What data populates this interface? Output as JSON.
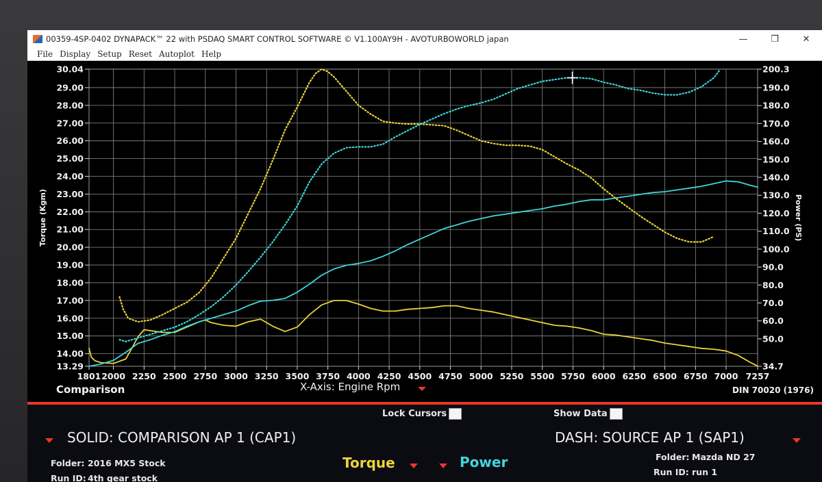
{
  "window": {
    "title": "00359-4SP-0402 DYNAPACK™ 22 with PSDAQ SMART CONTROL SOFTWARE © V1.100AY9H - AVOTURBOWORLD japan",
    "minimize": "—",
    "maximize": "❐",
    "close": "✕"
  },
  "menu": [
    "File",
    "Display",
    "Setup",
    "Reset",
    "Autoplot",
    "Help"
  ],
  "footer": {
    "comparison_label": "Comparison",
    "xaxis_label": "X-Axis: Engine Rpm",
    "din_label": "DIN 70020 (1976)"
  },
  "controls": {
    "lock_cursors": "Lock Cursors",
    "show_data": "Show Data"
  },
  "panel": {
    "solid_title": "SOLID: COMPARISON AP 1 (CAP1)",
    "dash_title": "DASH: SOURCE AP 1 (SAP1)",
    "left_folder_label": "Folder:",
    "left_folder_value": "2016 MX5 Stock",
    "left_runid_label": "Run ID:",
    "left_runid_value": "4th gear stock",
    "right_folder_label": "Folder:",
    "right_folder_value": "Mazda ND 27",
    "right_runid_label": "Run ID:",
    "right_runid_value": "run 1",
    "torque_label": "Torque",
    "power_label": "Power"
  },
  "colors": {
    "torque": "#ecd43a",
    "power": "#3fd6dc",
    "accent": "#e8382a",
    "grid": "#8a8a8a"
  },
  "chart_data": {
    "type": "line",
    "title": "",
    "xlabel": "X-Axis: Engine Rpm",
    "ylabel_left": "Torque (Kgm)",
    "ylabel_right": "Power (PS)",
    "xlim": [
      1801,
      7257
    ],
    "ylim_left": [
      13.29,
      30.04
    ],
    "ylim_right": [
      34.7,
      200.3
    ],
    "x_ticks": [
      "1801",
      "2000",
      "2250",
      "2500",
      "2750",
      "3000",
      "3250",
      "3500",
      "3750",
      "4000",
      "4250",
      "4500",
      "4750",
      "5000",
      "5250",
      "5500",
      "5750",
      "6000",
      "6250",
      "6500",
      "6750",
      "7000",
      "7257"
    ],
    "left_ticks": [
      "30.04",
      "29.00",
      "28.00",
      "27.00",
      "26.00",
      "25.00",
      "24.00",
      "23.00",
      "22.00",
      "21.00",
      "20.00",
      "19.00",
      "18.00",
      "17.00",
      "16.00",
      "15.00",
      "14.00",
      "13.29"
    ],
    "right_ticks": [
      "200.3",
      "190.0",
      "180.0",
      "170.0",
      "160.0",
      "150.0",
      "140.0",
      "130.0",
      "120.0",
      "110.0",
      "100.0",
      "90.0",
      "80.0",
      "70.0",
      "60.0",
      "50.0",
      "34.7"
    ],
    "grid": true,
    "series": [
      {
        "name": "Torque",
        "style": "solid",
        "axis": "left",
        "color": "#ecd43a",
        "x": [
          1801,
          1820,
          1850,
          1900,
          2000,
          2100,
          2150,
          2200,
          2250,
          2300,
          2400,
          2500,
          2600,
          2700,
          2750,
          2800,
          2900,
          3000,
          3100,
          3200,
          3300,
          3400,
          3500,
          3600,
          3700,
          3800,
          3900,
          4000,
          4100,
          4200,
          4300,
          4400,
          4500,
          4600,
          4700,
          4800,
          4900,
          5000,
          5100,
          5200,
          5300,
          5400,
          5500,
          5600,
          5700,
          5800,
          5900,
          6000,
          6100,
          6200,
          6300,
          6400,
          6500,
          6600,
          6700,
          6800,
          6900,
          7000,
          7100,
          7200,
          7257
        ],
        "y": [
          14.3,
          13.8,
          13.6,
          13.5,
          13.45,
          13.7,
          14.3,
          14.95,
          15.35,
          15.3,
          15.2,
          15.2,
          15.5,
          15.8,
          15.9,
          15.75,
          15.6,
          15.55,
          15.8,
          15.95,
          15.55,
          15.25,
          15.5,
          16.2,
          16.75,
          17.0,
          17.0,
          16.8,
          16.55,
          16.4,
          16.4,
          16.5,
          16.55,
          16.6,
          16.7,
          16.7,
          16.55,
          16.45,
          16.35,
          16.2,
          16.05,
          15.9,
          15.75,
          15.6,
          15.55,
          15.45,
          15.3,
          15.1,
          15.05,
          14.95,
          14.85,
          14.75,
          14.6,
          14.5,
          14.4,
          14.3,
          14.25,
          14.15,
          13.9,
          13.5,
          13.3
        ]
      },
      {
        "name": "Power",
        "style": "solid",
        "axis": "right",
        "color": "#3fd6dc",
        "x": [
          1801,
          1900,
          2000,
          2100,
          2200,
          2300,
          2400,
          2500,
          2600,
          2700,
          2800,
          2900,
          3000,
          3100,
          3200,
          3300,
          3400,
          3500,
          3600,
          3700,
          3800,
          3900,
          4000,
          4100,
          4200,
          4300,
          4400,
          4500,
          4600,
          4700,
          4800,
          4900,
          5000,
          5100,
          5200,
          5300,
          5400,
          5500,
          5600,
          5700,
          5800,
          5900,
          6000,
          6100,
          6200,
          6300,
          6400,
          6500,
          6600,
          6700,
          6800,
          6900,
          7000,
          7100,
          7200,
          7257
        ],
        "y": [
          34.7,
          36.0,
          38.0,
          42.5,
          47.5,
          49.5,
          52.0,
          54.0,
          57.0,
          59.5,
          61.5,
          63.5,
          65.5,
          68.5,
          71.0,
          71.5,
          72.5,
          76.0,
          80.5,
          85.5,
          89.0,
          91.0,
          92.0,
          93.5,
          96.0,
          99.0,
          102.5,
          105.5,
          108.5,
          111.5,
          113.5,
          115.5,
          117.0,
          118.5,
          119.5,
          120.5,
          121.5,
          122.5,
          124.0,
          125.0,
          126.5,
          127.5,
          127.5,
          128.5,
          129.5,
          130.5,
          131.5,
          132.0,
          133.0,
          134.0,
          135.0,
          136.5,
          138.0,
          137.5,
          135.5,
          134.5
        ]
      },
      {
        "name": "Torque",
        "style": "dashed",
        "axis": "left",
        "color": "#ecd43a",
        "x": [
          2050,
          2080,
          2120,
          2200,
          2300,
          2400,
          2500,
          2600,
          2700,
          2800,
          2900,
          3000,
          3100,
          3200,
          3300,
          3400,
          3500,
          3600,
          3650,
          3700,
          3750,
          3800,
          3900,
          4000,
          4100,
          4200,
          4300,
          4400,
          4500,
          4600,
          4700,
          4800,
          4900,
          5000,
          5100,
          5200,
          5300,
          5400,
          5500,
          5600,
          5700,
          5800,
          5900,
          6000,
          6100,
          6200,
          6300,
          6400,
          6500,
          6600,
          6700,
          6800,
          6900
        ],
        "y": [
          17.2,
          16.5,
          16.0,
          15.8,
          15.9,
          16.2,
          16.55,
          16.9,
          17.45,
          18.3,
          19.4,
          20.5,
          21.9,
          23.3,
          24.9,
          26.6,
          27.9,
          29.3,
          29.8,
          30.04,
          29.9,
          29.6,
          28.8,
          28.0,
          27.5,
          27.1,
          27.0,
          26.95,
          26.95,
          26.9,
          26.85,
          26.6,
          26.3,
          26.0,
          25.85,
          25.75,
          25.75,
          25.7,
          25.5,
          25.1,
          24.7,
          24.35,
          23.9,
          23.3,
          22.75,
          22.25,
          21.75,
          21.3,
          20.85,
          20.5,
          20.3,
          20.3,
          20.6
        ]
      },
      {
        "name": "Power",
        "style": "dashed",
        "axis": "right",
        "color": "#3fd6dc",
        "x": [
          2050,
          2100,
          2200,
          2300,
          2400,
          2500,
          2600,
          2700,
          2800,
          2900,
          3000,
          3100,
          3200,
          3300,
          3400,
          3500,
          3600,
          3700,
          3800,
          3900,
          4000,
          4100,
          4200,
          4300,
          4400,
          4500,
          4600,
          4700,
          4800,
          4900,
          5000,
          5100,
          5200,
          5300,
          5400,
          5500,
          5600,
          5700,
          5800,
          5900,
          6000,
          6100,
          6200,
          6300,
          6400,
          6500,
          6600,
          6700,
          6800,
          6900,
          6950
        ],
        "y": [
          49.5,
          48.5,
          50.5,
          52.5,
          54.5,
          56.5,
          59.5,
          63.5,
          68.0,
          73.5,
          80.0,
          87.5,
          95.5,
          104.0,
          113.5,
          124.0,
          137.5,
          147.5,
          153.5,
          156.5,
          157.0,
          157.0,
          158.5,
          162.5,
          166.0,
          169.5,
          172.5,
          175.5,
          178.0,
          180.0,
          181.5,
          183.5,
          186.5,
          189.5,
          191.5,
          193.5,
          194.5,
          195.5,
          195.5,
          195.0,
          193.0,
          191.5,
          189.5,
          188.5,
          187.0,
          186.0,
          186.0,
          187.5,
          190.5,
          195.5,
          200.0
        ]
      }
    ]
  }
}
